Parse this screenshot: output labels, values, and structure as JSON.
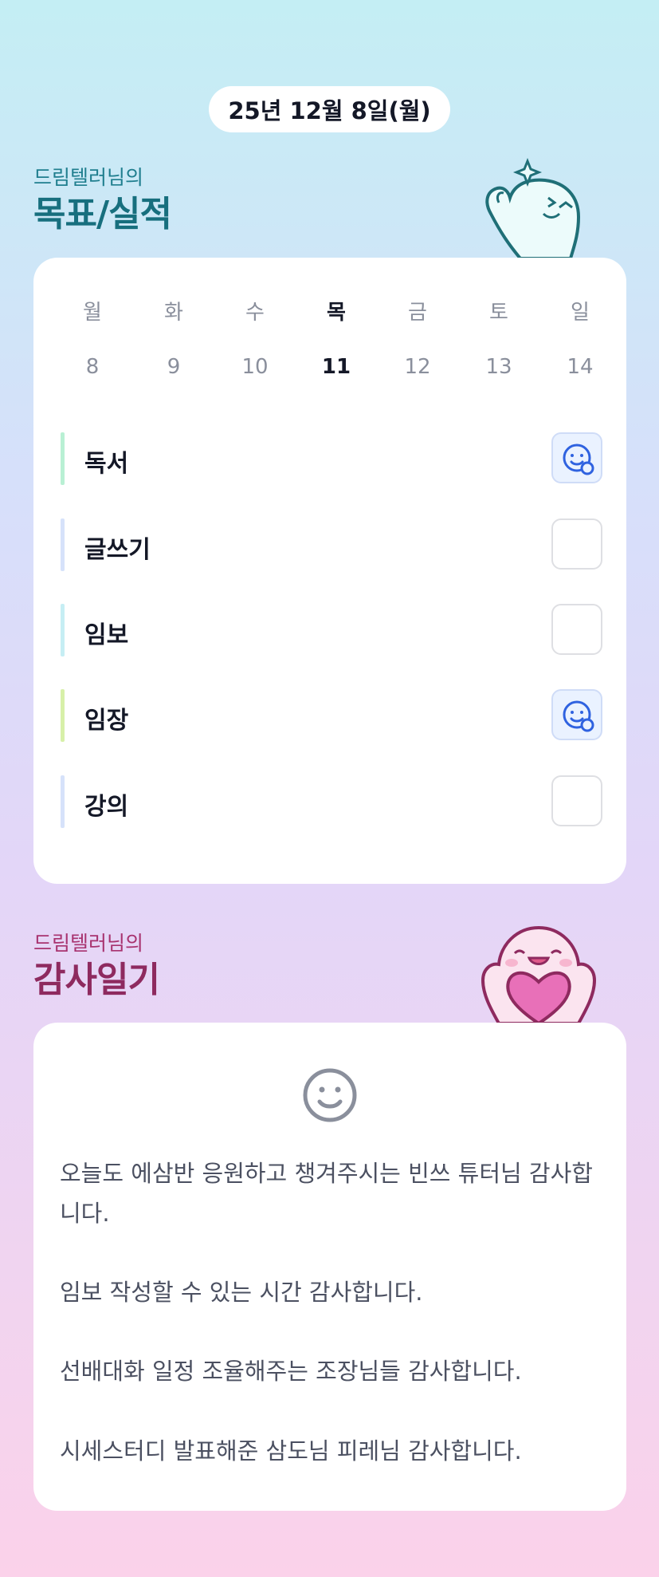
{
  "header": {
    "date": "25년 12월 8일(월)"
  },
  "goals_section": {
    "subtitle": "드림텔러님의",
    "title": "목표/실적",
    "weekdays": [
      "월",
      "화",
      "수",
      "목",
      "금",
      "토",
      "일"
    ],
    "dates": [
      "8",
      "9",
      "10",
      "11",
      "12",
      "13",
      "14"
    ],
    "today_index": 3,
    "items": [
      {
        "label": "독서",
        "done": true,
        "bar_color": "#b9f0d4",
        "icon": "smile-check-icon"
      },
      {
        "label": "글쓰기",
        "done": false,
        "bar_color": "#d6e2fa",
        "icon": ""
      },
      {
        "label": "임보",
        "done": false,
        "bar_color": "#c6eef4",
        "icon": ""
      },
      {
        "label": "임장",
        "done": true,
        "bar_color": "#d7f0a9",
        "icon": "smile-check-icon"
      },
      {
        "label": "강의",
        "done": false,
        "bar_color": "#d6e2fa",
        "icon": ""
      }
    ]
  },
  "thanks_section": {
    "subtitle": "드림텔러님의",
    "title": "감사일기",
    "icon": "smile-face-icon",
    "entries": [
      "오늘도 에삼반 응원하고 챙겨주시는 빈쓰 튜터님 감사합니다.",
      "임보 작성할 수 있는 시간 감사합니다.",
      "선배대화 일정 조율해주는 조장님들 감사합니다.",
      "시세스터디 발표해준 삼도님 피레님 감사합니다."
    ]
  },
  "colors": {
    "goal_title": "#176f7e",
    "thanks_title": "#8e2a5f",
    "check_icon": "#2f62e0"
  }
}
